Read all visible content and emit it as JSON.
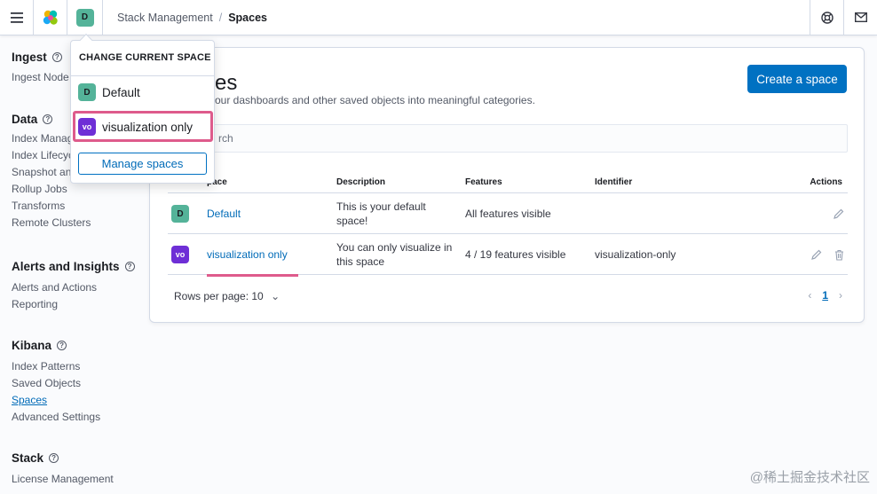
{
  "header": {
    "breadcrumbs": [
      "Stack Management",
      "Spaces"
    ],
    "current_space_initial": "D"
  },
  "sidenav": {
    "groups": [
      {
        "title": "Ingest",
        "items": [
          "Ingest Node"
        ]
      },
      {
        "title": "Data",
        "items": [
          "Index Manag",
          "Index Lifecyc",
          "Snapshot an",
          "Rollup Jobs",
          "Transforms",
          "Remote Clusters"
        ]
      },
      {
        "title": "Alerts and Insights",
        "items": [
          "Alerts and Actions",
          "Reporting"
        ]
      },
      {
        "title": "Kibana",
        "items": [
          "Index Patterns",
          "Saved Objects",
          "Spaces",
          "Advanced Settings"
        ]
      },
      {
        "title": "Stack",
        "items": [
          "License Management"
        ]
      }
    ]
  },
  "main": {
    "title": "es",
    "description": "our dashboards and other saved objects into meaningful categories.",
    "create_button": "Create a space",
    "search_placeholder": "rch",
    "table": {
      "columns": [
        "pace",
        "Description",
        "Features",
        "Identifier",
        "Actions"
      ],
      "rows": [
        {
          "initial": "D",
          "name": "Default",
          "description": "This is your default space!",
          "features": "All features visible",
          "identifier": ""
        },
        {
          "initial": "vo",
          "name": "visualization only",
          "description": "You can only visualize in this space",
          "features": "4 / 19 features visible",
          "identifier": "visualization-only"
        }
      ]
    },
    "rows_per_page": "Rows per page: 10",
    "current_page": "1"
  },
  "popover": {
    "title": "CHANGE CURRENT SPACE",
    "spaces": [
      {
        "initial": "D",
        "name": "Default"
      },
      {
        "initial": "vo",
        "name": "visualization only"
      }
    ],
    "manage_button": "Manage spaces"
  },
  "watermark": "@稀土掘金技术社区",
  "colors": {
    "accent": "#0071c2",
    "highlight": "#de5b8c",
    "default_avatar": "#54b399",
    "vo_avatar": "#6e2fd6"
  }
}
